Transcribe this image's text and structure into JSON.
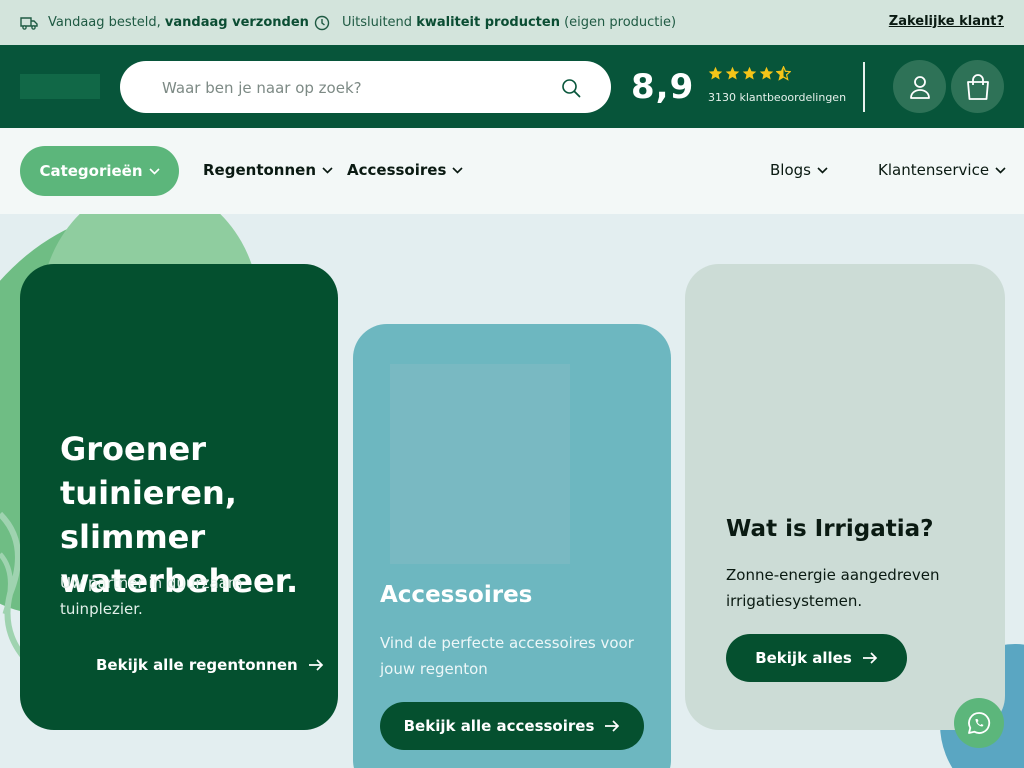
{
  "topbar": {
    "usp1_prefix": "Vandaag besteld, ",
    "usp1_bold": "vandaag verzonden",
    "usp2_prefix": "Uitsluitend ",
    "usp2_bold": "kwaliteit producten",
    "usp2_suffix": " (eigen productie)",
    "business_link": "Zakelijke klant?"
  },
  "header": {
    "search_placeholder": "Waar ben je naar op zoek?",
    "rating_score": "8,9",
    "rating_stars": 4.5,
    "review_count": "3130 klantbeoordelingen",
    "icons": {
      "search": "search-icon",
      "account": "user-icon",
      "cart": "shopping-bag-icon"
    }
  },
  "nav": {
    "categories": "Categorieën",
    "items": [
      "Regentonnen",
      "Accessoires"
    ],
    "right_items": [
      "Blogs",
      "Klantenservice"
    ]
  },
  "hero": {
    "card1": {
      "title": "Groener tuinieren, slimmer waterbeheer.",
      "subtitle": "Uw partner in duurzaam tuinplezier.",
      "link": "Bekijk alle regentonnen"
    },
    "card2": {
      "title": "Accessoires",
      "subtitle": "Vind de perfecte accessoires voor jouw regenton",
      "button": "Bekijk alle accessoires"
    },
    "card3": {
      "title": "Wat is Irrigatia?",
      "subtitle": "Zonne-energie aangedreven irrigatiesystemen.",
      "button": "Bekijk alles"
    }
  },
  "colors": {
    "brand_dark": "#07553a",
    "brand_green": "#5cb67b",
    "star": "#f5c518",
    "teal": "#6db7c0"
  }
}
